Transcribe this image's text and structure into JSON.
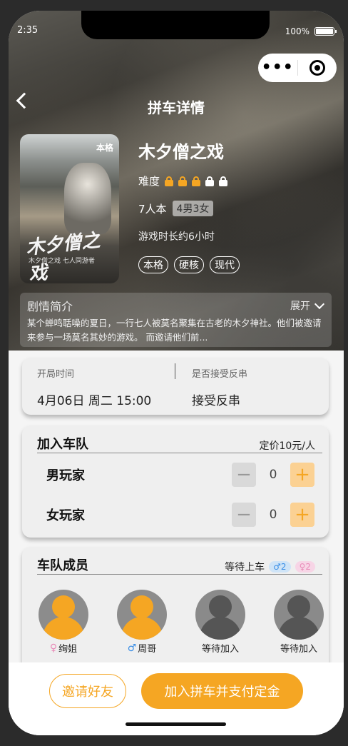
{
  "status": {
    "time": "2:35",
    "battery": "100%"
  },
  "nav": {
    "title": "拼车详情"
  },
  "game": {
    "poster_tag": "本格",
    "poster_title": "木夕僧之戏",
    "poster_subtitle": "木夕僧之戏 七人同游者",
    "title": "木夕僧之戏",
    "difficulty_label": "难度",
    "difficulty": {
      "filled": 3,
      "total": 5
    },
    "player_count": "7人本",
    "gender_split": "4男3女",
    "duration": "游戏时长约6小时",
    "tags": [
      "本格",
      "硬核",
      "现代"
    ]
  },
  "synopsis": {
    "title": "剧情简介",
    "expand": "展开",
    "text": "某个蝉鸣聒噪的夏日，一行七人被莫名聚集在古老的木夕神社。他们被邀请来参与一场莫名其妙的游戏。 而邀请他们前..."
  },
  "schedule": {
    "start_label": "开局时间",
    "start_value": "4月06日 周二 15:00",
    "reverse_label": "是否接受反串",
    "reverse_value": "接受反串"
  },
  "join": {
    "title": "加入车队",
    "price": "定价10元/人",
    "rows": [
      {
        "label": "男玩家",
        "qty": "0",
        "minus": "−",
        "plus": "+"
      },
      {
        "label": "女玩家",
        "qty": "0",
        "minus": "−",
        "plus": "+"
      }
    ]
  },
  "team": {
    "title": "车队成员",
    "waiting_label": "等待上车",
    "waiting_male": "♂2",
    "waiting_female": "♀2",
    "members": [
      {
        "name": "绚姐",
        "gender": "♀"
      },
      {
        "name": "周哥",
        "gender": "♂"
      },
      {
        "name": "等待加入",
        "gender": ""
      },
      {
        "name": "等待加入",
        "gender": ""
      }
    ]
  },
  "actions": {
    "invite": "邀请好友",
    "join": "加入拼车并支付定金"
  }
}
